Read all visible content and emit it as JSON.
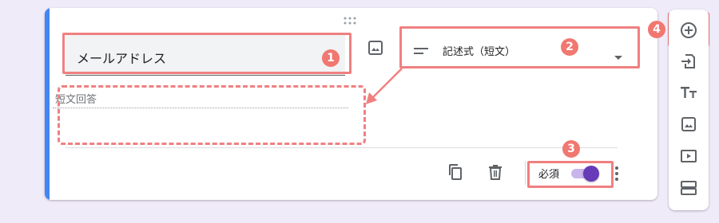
{
  "question": {
    "title": "メールアドレス",
    "answer_type": "記述式（短文）",
    "answer_placeholder": "短文回答",
    "required_label": "必須",
    "required": true
  },
  "annotations": [
    "1",
    "2",
    "3",
    "4"
  ],
  "icons": {
    "image": "image-icon",
    "short-answer": "short-text-icon",
    "dropdown": "arrow-drop-down-icon",
    "copy": "copy-icon",
    "delete": "trash-icon",
    "more": "more-vert-icon",
    "drag": "drag-handle-icon"
  },
  "toolbar": [
    {
      "name": "add-question",
      "icon": "add-circle-icon"
    },
    {
      "name": "import-questions",
      "icon": "import-icon"
    },
    {
      "name": "add-title",
      "icon": "title-text-icon"
    },
    {
      "name": "add-image",
      "icon": "image-icon"
    },
    {
      "name": "add-video",
      "icon": "video-icon"
    },
    {
      "name": "add-section",
      "icon": "section-icon"
    }
  ],
  "colors": {
    "background": "#f0ebf8",
    "accent_bar": "#4285f4",
    "toggle_on": "#673ab7",
    "annotation": "#f08080"
  }
}
